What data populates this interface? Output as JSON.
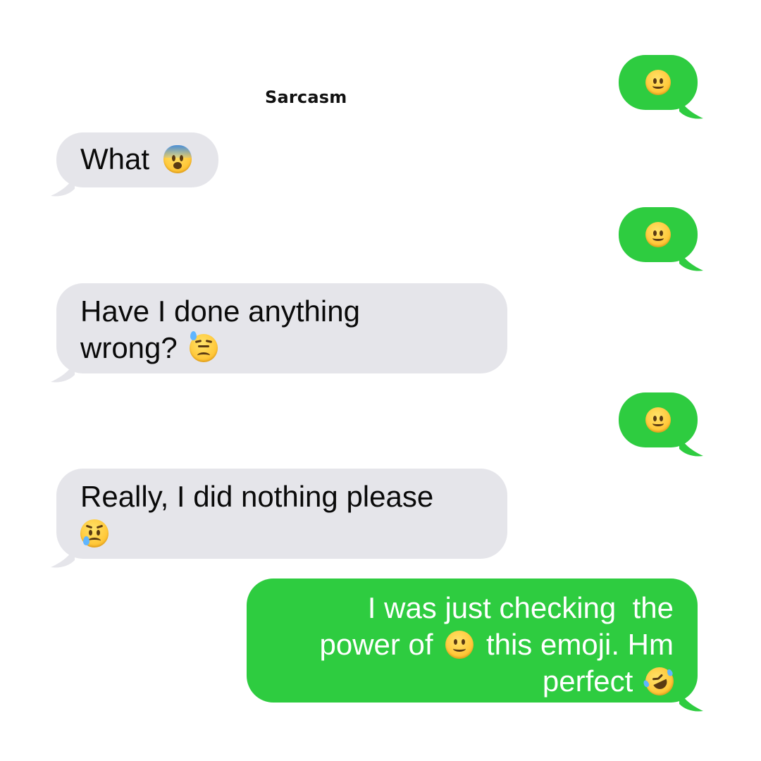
{
  "chat": {
    "title": "Sarcasm",
    "messages": [
      {
        "id": "m1",
        "direction": "outgoing",
        "text": "",
        "emoji": "slightly-smiling-face"
      },
      {
        "id": "m2",
        "direction": "incoming",
        "text": "What",
        "emoji": "fearful-face"
      },
      {
        "id": "m3",
        "direction": "outgoing",
        "text": "",
        "emoji": "slightly-smiling-face"
      },
      {
        "id": "m4",
        "direction": "incoming",
        "line1": "Have I done anything",
        "line2": "wrong?",
        "emoji": "downcast-face-with-sweat"
      },
      {
        "id": "m5",
        "direction": "outgoing",
        "text": "",
        "emoji": "slightly-smiling-face"
      },
      {
        "id": "m6",
        "direction": "incoming",
        "line1": "Really, I did nothing please",
        "emoji": "crying-face"
      },
      {
        "id": "m7",
        "direction": "outgoing",
        "line1": "I was just checking  the",
        "line2a": "power of",
        "line2b": "this emoji. Hm",
        "line3": "perfect",
        "emoji_inline": "slightly-smiling-face",
        "emoji_end": "rolling-on-the-floor-laughing"
      }
    ]
  },
  "colors": {
    "incoming_bubble": "#e5e5ea",
    "outgoing_bubble": "#2ecc40",
    "outgoing_text": "#ffffff",
    "incoming_text": "#0a0a0a"
  }
}
